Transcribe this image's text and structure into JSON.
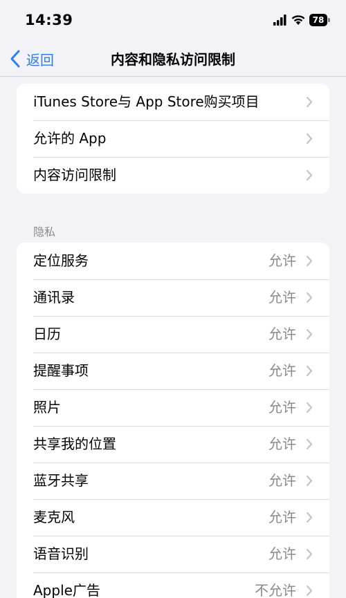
{
  "status_bar": {
    "time": "14:39",
    "battery": "78"
  },
  "nav": {
    "back_label": "返回",
    "title": "内容和隐私访问限制"
  },
  "group1": {
    "items": [
      {
        "label": "iTunes Store与 App Store购买项目"
      },
      {
        "label": "允许的 App"
      },
      {
        "label": "内容访问限制"
      }
    ]
  },
  "privacy": {
    "header": "隐私",
    "items": [
      {
        "label": "定位服务",
        "value": "允许"
      },
      {
        "label": "通讯录",
        "value": "允许"
      },
      {
        "label": "日历",
        "value": "允许"
      },
      {
        "label": "提醒事项",
        "value": "允许"
      },
      {
        "label": "照片",
        "value": "允许"
      },
      {
        "label": "共享我的位置",
        "value": "允许"
      },
      {
        "label": "蓝牙共享",
        "value": "允许"
      },
      {
        "label": "麦克风",
        "value": "允许"
      },
      {
        "label": "语音识别",
        "value": "允许"
      },
      {
        "label": "Apple广告",
        "value": "不允许"
      }
    ]
  },
  "colors": {
    "accent": "#2f7cf6",
    "background": "#f2f2f7",
    "secondary_text": "#8a8a8e"
  }
}
